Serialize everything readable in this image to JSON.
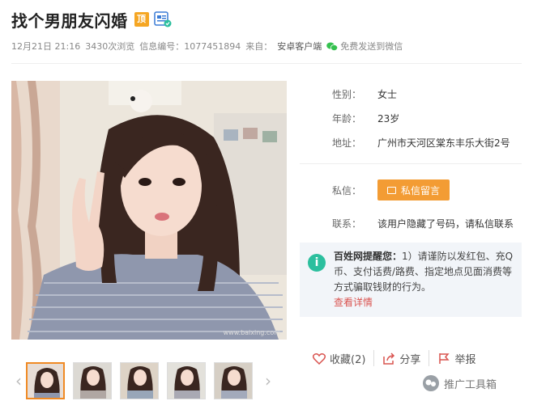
{
  "post": {
    "title": "找个男朋友闪婚",
    "top_badge": "顶",
    "date": "12月21日 21:16",
    "views": "3430次浏览",
    "id_label": "信息编号：1077451894",
    "source_label": "来自：",
    "source_value": "安卓客户端",
    "wechat_share": "免费发送到微信"
  },
  "profile": {
    "gender_label": "性别：",
    "gender_value": "女士",
    "age_label": "年龄：",
    "age_value": "23岁",
    "address_label": "地址：",
    "address_value": "广州市天河区棠东丰乐大街2号",
    "message_label": "私信：",
    "message_button": "私信留言",
    "contact_label": "联系：",
    "contact_value": "该用户隐藏了号码，请私信联系"
  },
  "notice": {
    "icon": "i",
    "title": "百姓网提醒您：",
    "body": "1）请谨防以发红包、充Q币、支付话费/路费、指定地点见面消费等方式骗取钱财的行为。",
    "link": "查看详情"
  },
  "photo": {
    "watermark": "www.baixing.com"
  },
  "actions": {
    "favorite": "收藏(2)",
    "share": "分享",
    "report": "举报"
  },
  "gallery": {
    "prev": "‹",
    "next": "›",
    "thumbnail_count": 5,
    "active_index": 0
  },
  "brand_watermark": "推广工具箱",
  "colors": {
    "accent_orange": "#f39c34",
    "notice_green": "#2cbf9e",
    "link_red": "#d9534f"
  }
}
